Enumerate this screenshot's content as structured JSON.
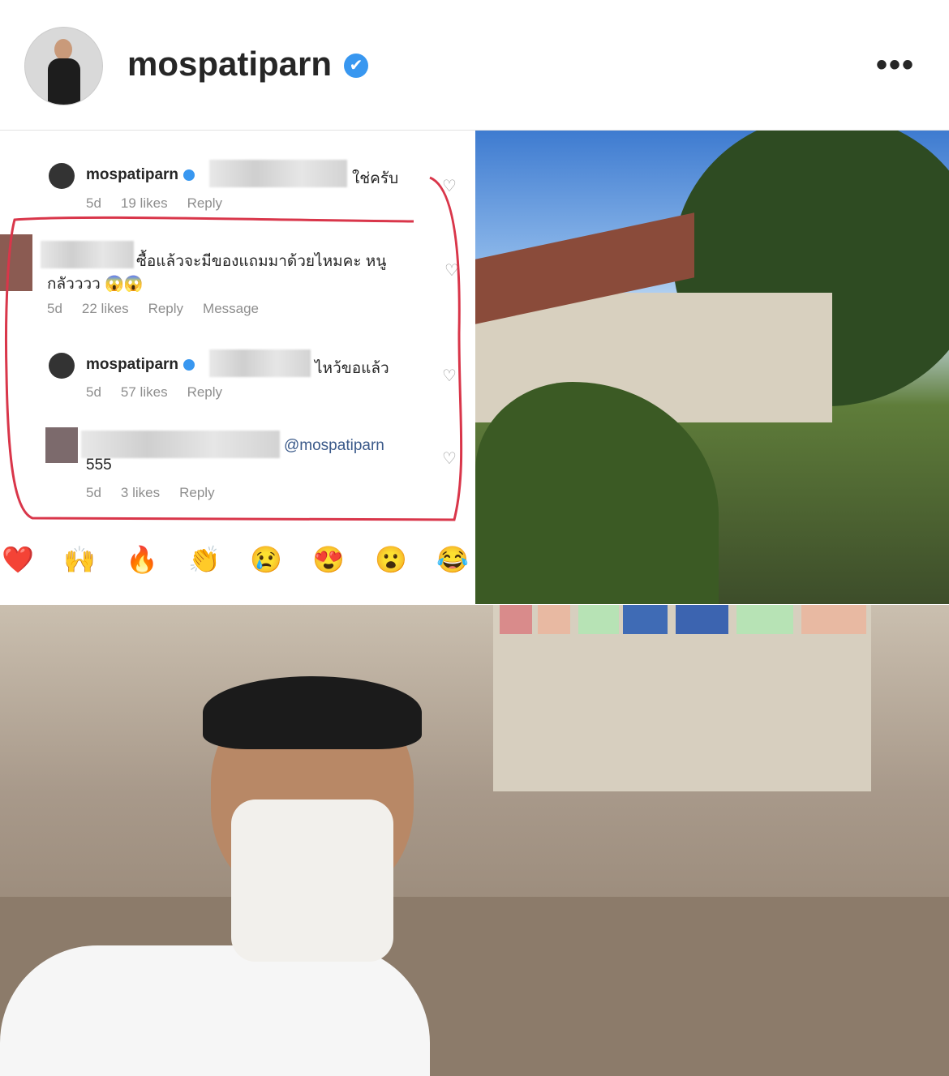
{
  "header": {
    "username": "mospatiparn",
    "verified_icon": "verified-badge-icon",
    "more_icon": "more-options-icon"
  },
  "comments": [
    {
      "username": "mospatiparn",
      "text": "ใช่ครับ",
      "age": "5d",
      "likes": "19 likes",
      "reply": "Reply"
    },
    {
      "username": "",
      "text": "ซื้อแล้วจะมีของแถมมาด้วยไหมคะ หนู",
      "text2": "กลัวววว 😱😱",
      "age": "5d",
      "likes": "22 likes",
      "reply": "Reply",
      "message": "Message"
    },
    {
      "username": "mospatiparn",
      "text": "ไหว้ขอแล้ว",
      "age": "5d",
      "likes": "57 likes",
      "reply": "Reply"
    },
    {
      "username": "",
      "mention": "@mospatiparn",
      "text": "555",
      "age": "5d",
      "likes": "3 likes",
      "reply": "Reply"
    }
  ],
  "reactions": [
    "❤️",
    "🙌",
    "🔥",
    "👏",
    "😢",
    "😍",
    "😮",
    "😂"
  ],
  "colors": {
    "accent": "#3897f0",
    "annotation": "#d9364a",
    "meta": "#8e8e8e"
  }
}
